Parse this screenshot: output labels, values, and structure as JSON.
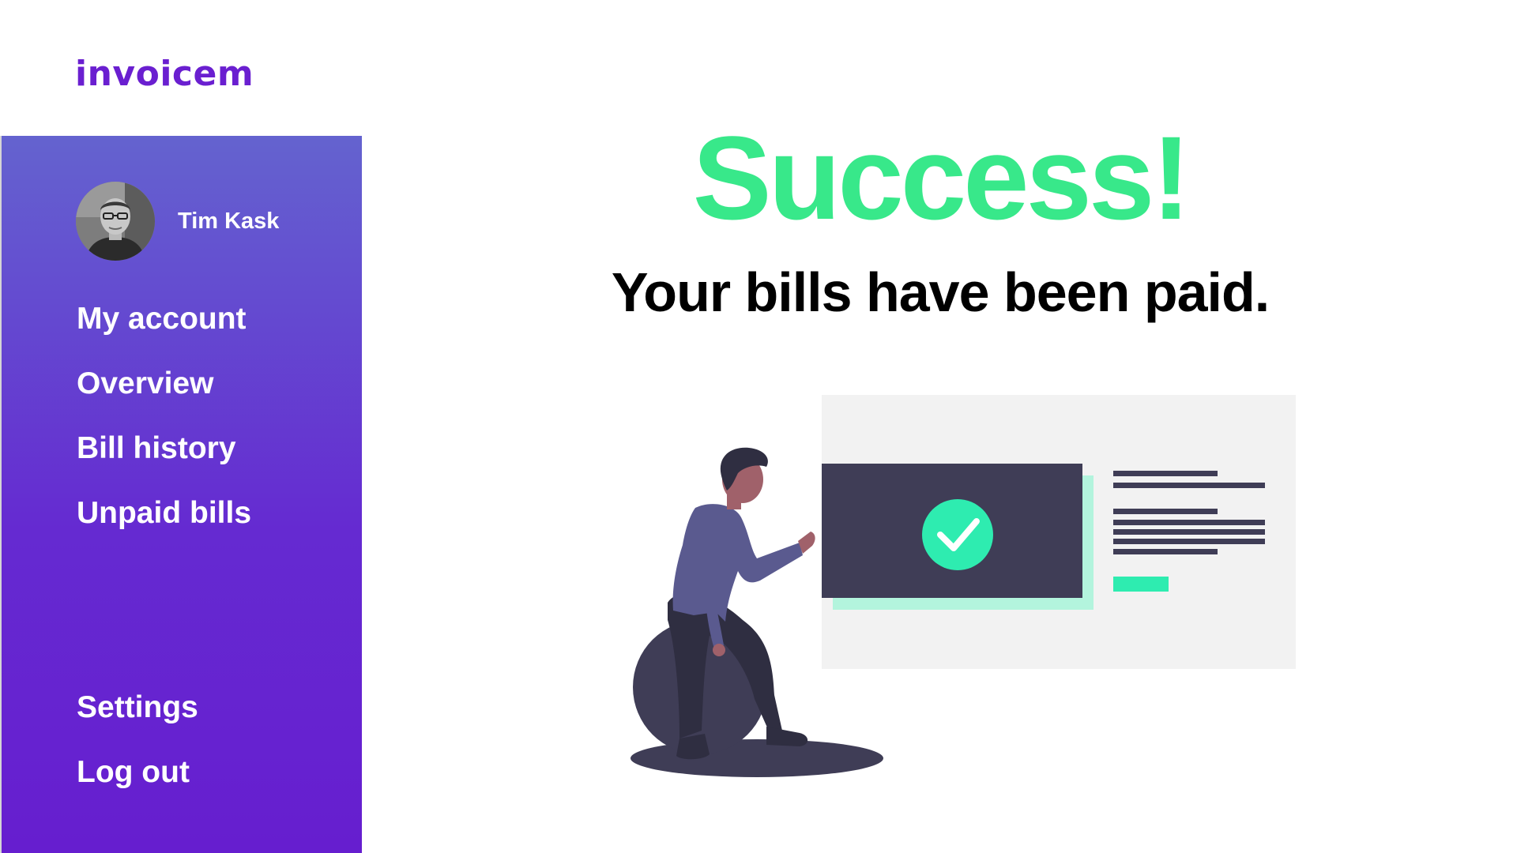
{
  "brand": {
    "logo_text": "invoicem",
    "accent_color": "#6a1fd0"
  },
  "sidebar": {
    "user": {
      "name": "Tim Kask"
    },
    "nav": [
      {
        "label": "My account"
      },
      {
        "label": "Overview"
      },
      {
        "label": "Bill history"
      },
      {
        "label": "Unpaid bills"
      }
    ],
    "footer_nav": [
      {
        "label": "Settings"
      },
      {
        "label": "Log out"
      }
    ]
  },
  "main": {
    "title": "Success!",
    "title_color": "#38e88a",
    "subtitle": "Your bills have been paid.",
    "illustration_icon": "check-circle-icon"
  }
}
